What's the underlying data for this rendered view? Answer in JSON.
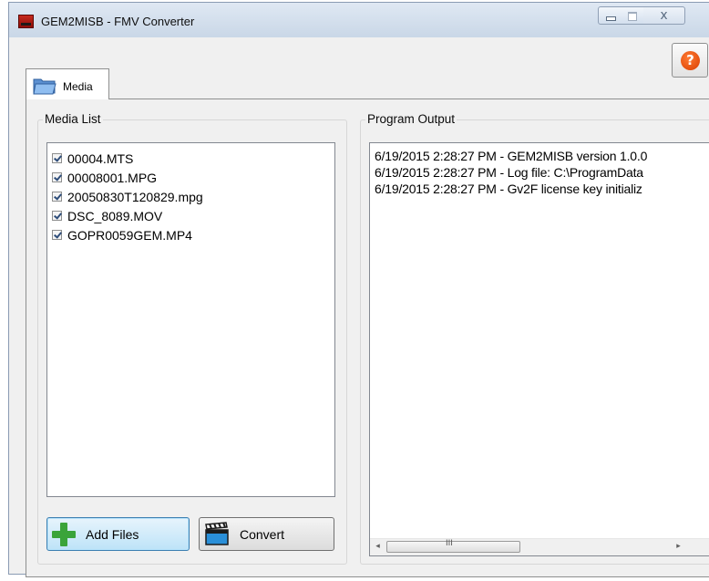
{
  "window": {
    "title": "GEM2MISB - FMV Converter",
    "close_glyph": "x"
  },
  "help_button": {
    "glyph": "?"
  },
  "tabs": [
    {
      "label": "Media",
      "icon": "folder-icon",
      "selected": true
    }
  ],
  "media_list": {
    "label": "Media List",
    "items": [
      {
        "name": "00004.MTS",
        "checked": true
      },
      {
        "name": "00008001.MPG",
        "checked": true
      },
      {
        "name": "20050830T120829.mpg",
        "checked": true
      },
      {
        "name": "DSC_8089.MOV",
        "checked": true
      },
      {
        "name": "GOPR0059GEM.MP4",
        "checked": true
      }
    ]
  },
  "buttons": {
    "add_files": {
      "label": "Add Files",
      "icon": "plus-icon"
    },
    "convert": {
      "label": "Convert",
      "icon": "clapperboard-icon"
    }
  },
  "program_output": {
    "label": "Program Output",
    "lines": [
      "6/19/2015 2:28:27 PM - GEM2MISB version 1.0.0",
      "6/19/2015 2:28:27 PM - Log file: C:\\ProgramData",
      "6/19/2015 2:28:27 PM - Gv2F license key initializ"
    ],
    "scrollbar": {
      "left_arrow": "◂",
      "right_arrow": "▸",
      "grip": "III"
    }
  },
  "colors": {
    "title_bar": "#d6e2ef",
    "app_icon": "#b3201a",
    "help_icon": "#e84e0f",
    "add_button_hover": "#bde3f8",
    "plus_icon": "#3aa43a"
  }
}
